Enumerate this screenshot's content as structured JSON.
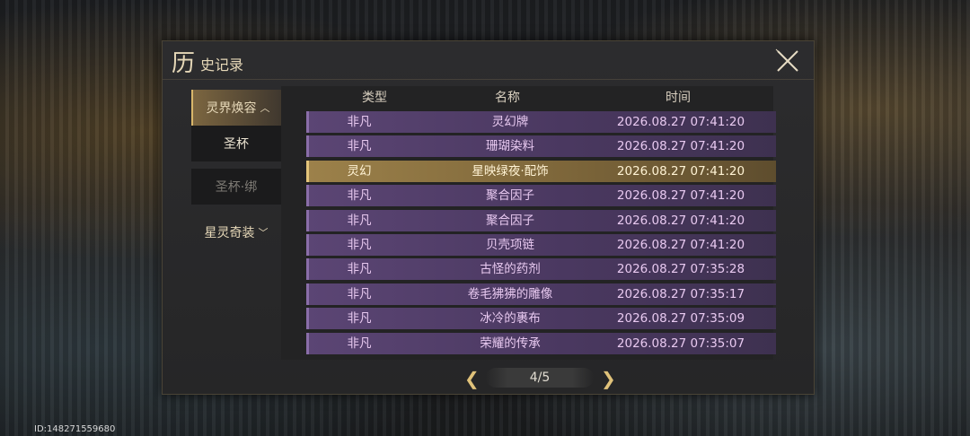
{
  "dialog": {
    "title_big": "历",
    "title_rest": "史记录",
    "close_icon": "close-x-icon"
  },
  "sidebar": {
    "categories": [
      {
        "label": "灵界焕容",
        "expanded": true
      },
      {
        "label": "星灵奇装",
        "expanded": false
      }
    ],
    "subitems": [
      {
        "label": "圣杯",
        "enabled": true
      },
      {
        "label": "圣杯·绑",
        "enabled": false
      }
    ]
  },
  "table": {
    "headers": [
      "类型",
      "名称",
      "时间"
    ],
    "rows": [
      {
        "type": "非凡",
        "name": "灵幻牌",
        "time": "2026.08.27 07:41:20",
        "highlight": false
      },
      {
        "type": "非凡",
        "name": "珊瑚染料",
        "time": "2026.08.27 07:41:20",
        "highlight": false
      },
      {
        "type": "灵幻",
        "name": "星映绿夜·配饰",
        "time": "2026.08.27 07:41:20",
        "highlight": true
      },
      {
        "type": "非凡",
        "name": "聚合因子",
        "time": "2026.08.27 07:41:20",
        "highlight": false
      },
      {
        "type": "非凡",
        "name": "聚合因子",
        "time": "2026.08.27 07:41:20",
        "highlight": false
      },
      {
        "type": "非凡",
        "name": "贝壳项链",
        "time": "2026.08.27 07:41:20",
        "highlight": false
      },
      {
        "type": "非凡",
        "name": "古怪的药剂",
        "time": "2026.08.27 07:35:28",
        "highlight": false
      },
      {
        "type": "非凡",
        "name": "卷毛狒狒的雕像",
        "time": "2026.08.27 07:35:17",
        "highlight": false
      },
      {
        "type": "非凡",
        "name": "冰冷的裹布",
        "time": "2026.08.27 07:35:09",
        "highlight": false
      },
      {
        "type": "非凡",
        "name": "荣耀的传承",
        "time": "2026.08.27 07:35:07",
        "highlight": false
      }
    ]
  },
  "pager": {
    "text": "4/5",
    "prev_icon": "chevron-left-icon",
    "next_icon": "chevron-right-icon"
  },
  "footer": {
    "id_text": "ID:148271559680"
  },
  "colors": {
    "accent_gold": "#d9b66a",
    "row_purple": "#5b4574",
    "row_gold": "#9c814a",
    "text_purple": "#e8c9f0"
  }
}
